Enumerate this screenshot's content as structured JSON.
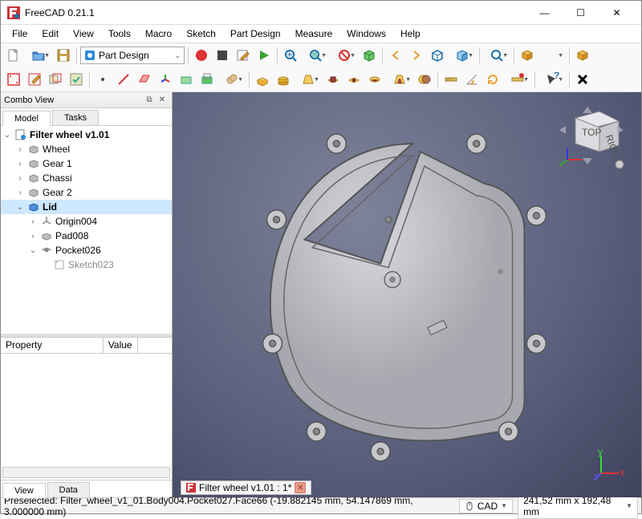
{
  "title": "FreeCAD 0.21.1",
  "menu": [
    "File",
    "Edit",
    "View",
    "Tools",
    "Macro",
    "Sketch",
    "Part Design",
    "Measure",
    "Windows",
    "Help"
  ],
  "workbench": "Part Design",
  "combo": {
    "title": "Combo View",
    "tabs": [
      "Model",
      "Tasks"
    ],
    "tree": {
      "root": "Filter wheel v1.01",
      "items": [
        "Wheel",
        "Gear 1",
        "Chassi",
        "Gear 2",
        "Lid"
      ],
      "lid_children": [
        "Origin004",
        "Pad008",
        "Pocket026"
      ],
      "pocket_child": "Sketch023"
    },
    "prop_cols": [
      "Property",
      "Value"
    ],
    "bottom_tabs": [
      "View",
      "Data"
    ]
  },
  "navcube": {
    "top": "TOP",
    "right": "RIGHT"
  },
  "doc_tab": "Filter wheel v1.01 : 1*",
  "status": {
    "main": "Preselected: Filter_wheel_v1_01.Body004.Pocket027.Face66 (-19.882145 mm, 54.147869 mm, 3.000000 mm)",
    "nav_mode": "CAD",
    "dims": "241,52 mm x 192,48 mm"
  },
  "icons": {
    "minimize": "—",
    "maximize": "☐",
    "close": "✕",
    "detach": "⧉",
    "x_small": "✕"
  }
}
